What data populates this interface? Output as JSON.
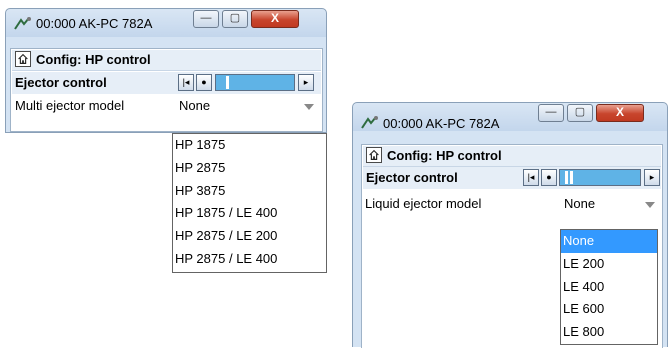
{
  "left_window": {
    "title": "00:000 AK-PC 782A",
    "buttons": {
      "minimize": "—",
      "maximize": "▢",
      "close": "X"
    },
    "config_title": "Config: HP control",
    "group_label": "Ejector control",
    "param_label": "Multi ejector model",
    "param_value": "None",
    "options": [
      "HP 1875",
      "HP 2875",
      "HP 3875",
      "HP 1875 / LE 400",
      "HP 2875 / LE 200",
      "HP 2875 / LE 400"
    ]
  },
  "right_window": {
    "title": "00:000 AK-PC 782A",
    "buttons": {
      "minimize": "—",
      "maximize": "▢",
      "close": "X"
    },
    "config_title": "Config: HP control",
    "group_label": "Ejector control",
    "param_label": "Liquid ejector model",
    "param_value": "None",
    "options": [
      "None",
      "LE 200",
      "LE 400",
      "LE 600",
      "LE 800"
    ],
    "selected_option": "None"
  },
  "icons": {
    "app": "hp-app-icon",
    "home": "home-icon",
    "nav_first": "nav-first-icon",
    "nav_prev": "nav-step-icon",
    "nav_next": "nav-next-icon"
  },
  "colors": {
    "selection": "#3399ff",
    "nav_bar": "#5fb3e6",
    "close_button": "#c8452d"
  }
}
